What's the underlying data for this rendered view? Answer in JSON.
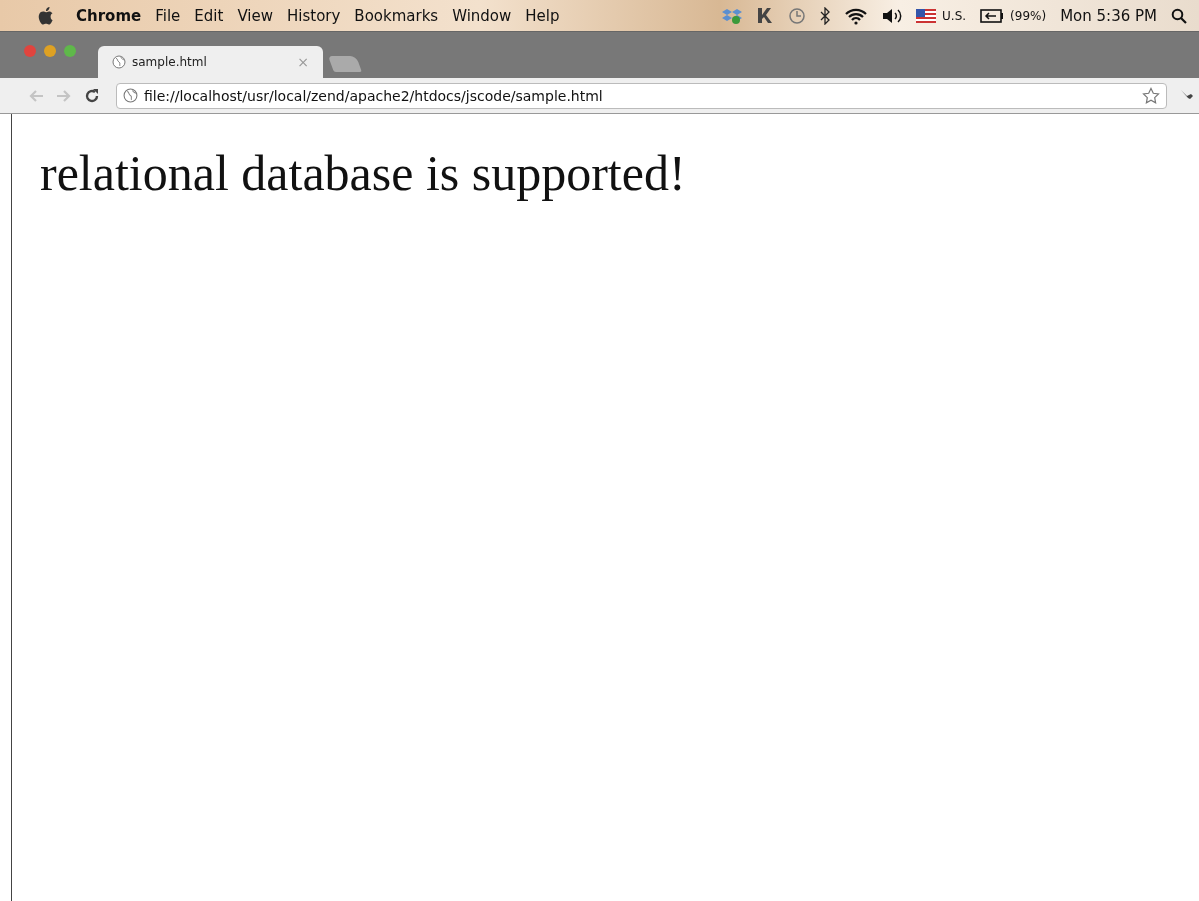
{
  "menu_bar": {
    "app_name": "Chrome",
    "menus": [
      "File",
      "Edit",
      "View",
      "History",
      "Bookmarks",
      "Window",
      "Help"
    ],
    "input_source": "U.S.",
    "battery": "(99%)",
    "clock": "Mon 5:36 PM"
  },
  "tabs": [
    {
      "title": "sample.html",
      "close": "×",
      "selected": true
    }
  ],
  "toolbar": {
    "back_disabled": true,
    "forward_disabled": true,
    "address": "file://localhost/usr/local/zend/apache2/htdocs/jscode/sample.html"
  },
  "page": {
    "heading": "relational database is supported!"
  }
}
